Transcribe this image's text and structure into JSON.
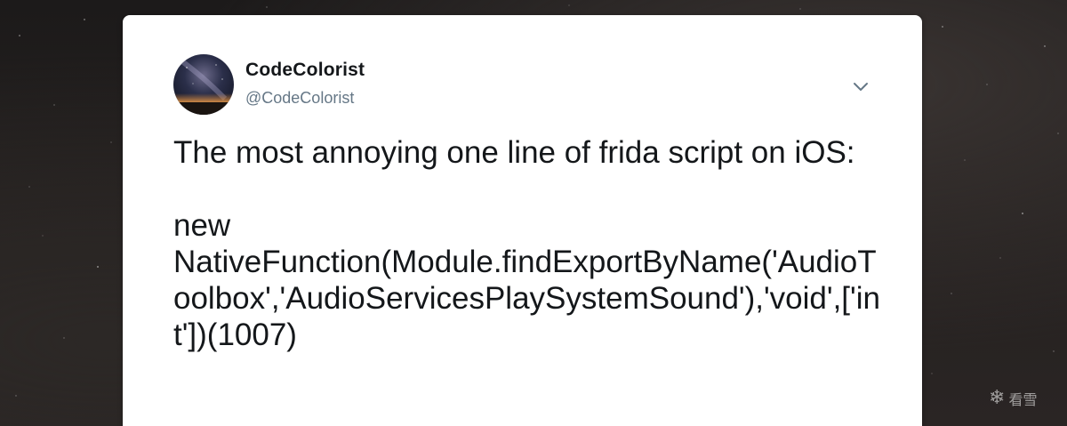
{
  "tweet": {
    "author": {
      "display_name": "CodeColorist",
      "handle": "@CodeColorist"
    },
    "menu_icon": "chevron-down-icon",
    "text": "The most annoying one line of frida script on iOS:\n\nnew\nNativeFunction(Module.findExportByName('AudioToolbox','AudioServicesPlaySystemSound'),'void',['int'])(1007)"
  },
  "watermark": {
    "icon": "snowflake-icon",
    "text": "看雪"
  },
  "colors": {
    "card_background": "#ffffff",
    "primary_text": "#14171a",
    "secondary_text": "#657786"
  }
}
